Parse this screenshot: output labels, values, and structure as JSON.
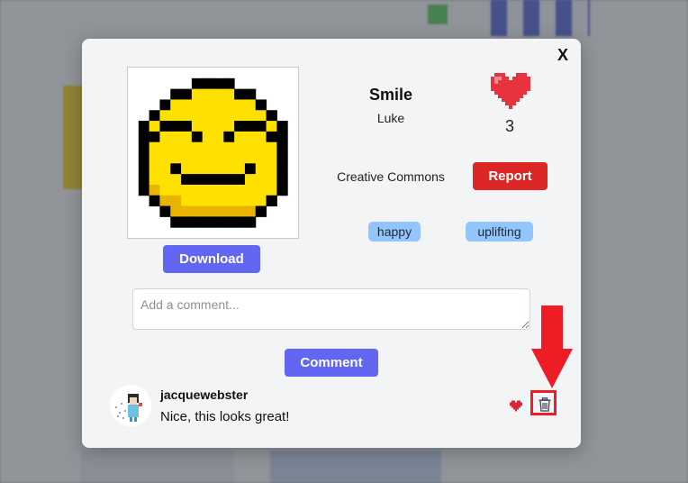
{
  "modal": {
    "close_label": "X",
    "title": "Smile",
    "author": "Luke",
    "likes": "3",
    "license": "Creative Commons",
    "report_label": "Report",
    "download_label": "Download",
    "tags": [
      "happy",
      "uplifting"
    ]
  },
  "comment_form": {
    "placeholder": "Add a comment...",
    "submit_label": "Comment"
  },
  "comments": [
    {
      "username": "jacquewebster",
      "text": "Nice, this looks great!"
    }
  ],
  "colors": {
    "primary_button": "#6366f1",
    "report_button": "#dc2626",
    "tag_bg": "#93c5fd",
    "heart": "#e8323e",
    "annotation": "#ee1c25",
    "smiley_yellow": "#ffe100",
    "smiley_shade": "#e8b400"
  },
  "icons": {
    "close": "close-icon",
    "like": "heart-icon",
    "delete": "trash-icon"
  }
}
